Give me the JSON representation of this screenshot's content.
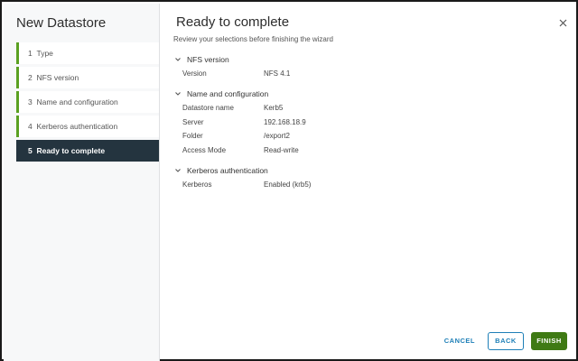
{
  "sidebar": {
    "title": "New Datastore",
    "steps": [
      {
        "num": "1",
        "label": "Type"
      },
      {
        "num": "2",
        "label": "NFS version"
      },
      {
        "num": "3",
        "label": "Name and configuration"
      },
      {
        "num": "4",
        "label": "Kerberos authentication"
      },
      {
        "num": "5",
        "label": "Ready to complete"
      }
    ]
  },
  "main": {
    "title": "Ready to complete",
    "subtitle": "Review your selections before finishing the wizard",
    "sections": [
      {
        "title": "NFS version",
        "rows": [
          {
            "key": "Version",
            "value": "NFS 4.1"
          }
        ]
      },
      {
        "title": "Name and configuration",
        "rows": [
          {
            "key": "Datastore name",
            "value": "Kerb5"
          },
          {
            "key": "Server",
            "value": "192.168.18.9"
          },
          {
            "key": "Folder",
            "value": "/export2"
          },
          {
            "key": "Access Mode",
            "value": "Read-write"
          }
        ]
      },
      {
        "title": "Kerberos authentication",
        "rows": [
          {
            "key": "Kerberos",
            "value": "Enabled (krb5)"
          }
        ]
      }
    ]
  },
  "footer": {
    "cancel_label": "CANCEL",
    "back_label": "BACK",
    "finish_label": "FINISH"
  },
  "icons": {
    "close": "close-icon",
    "expand": "chevron-down-icon"
  },
  "colors": {
    "accent_green": "#5aa021",
    "active_step_bg": "#24343f",
    "link_blue": "#1e7fb7",
    "finish_green": "#3f7a14"
  }
}
